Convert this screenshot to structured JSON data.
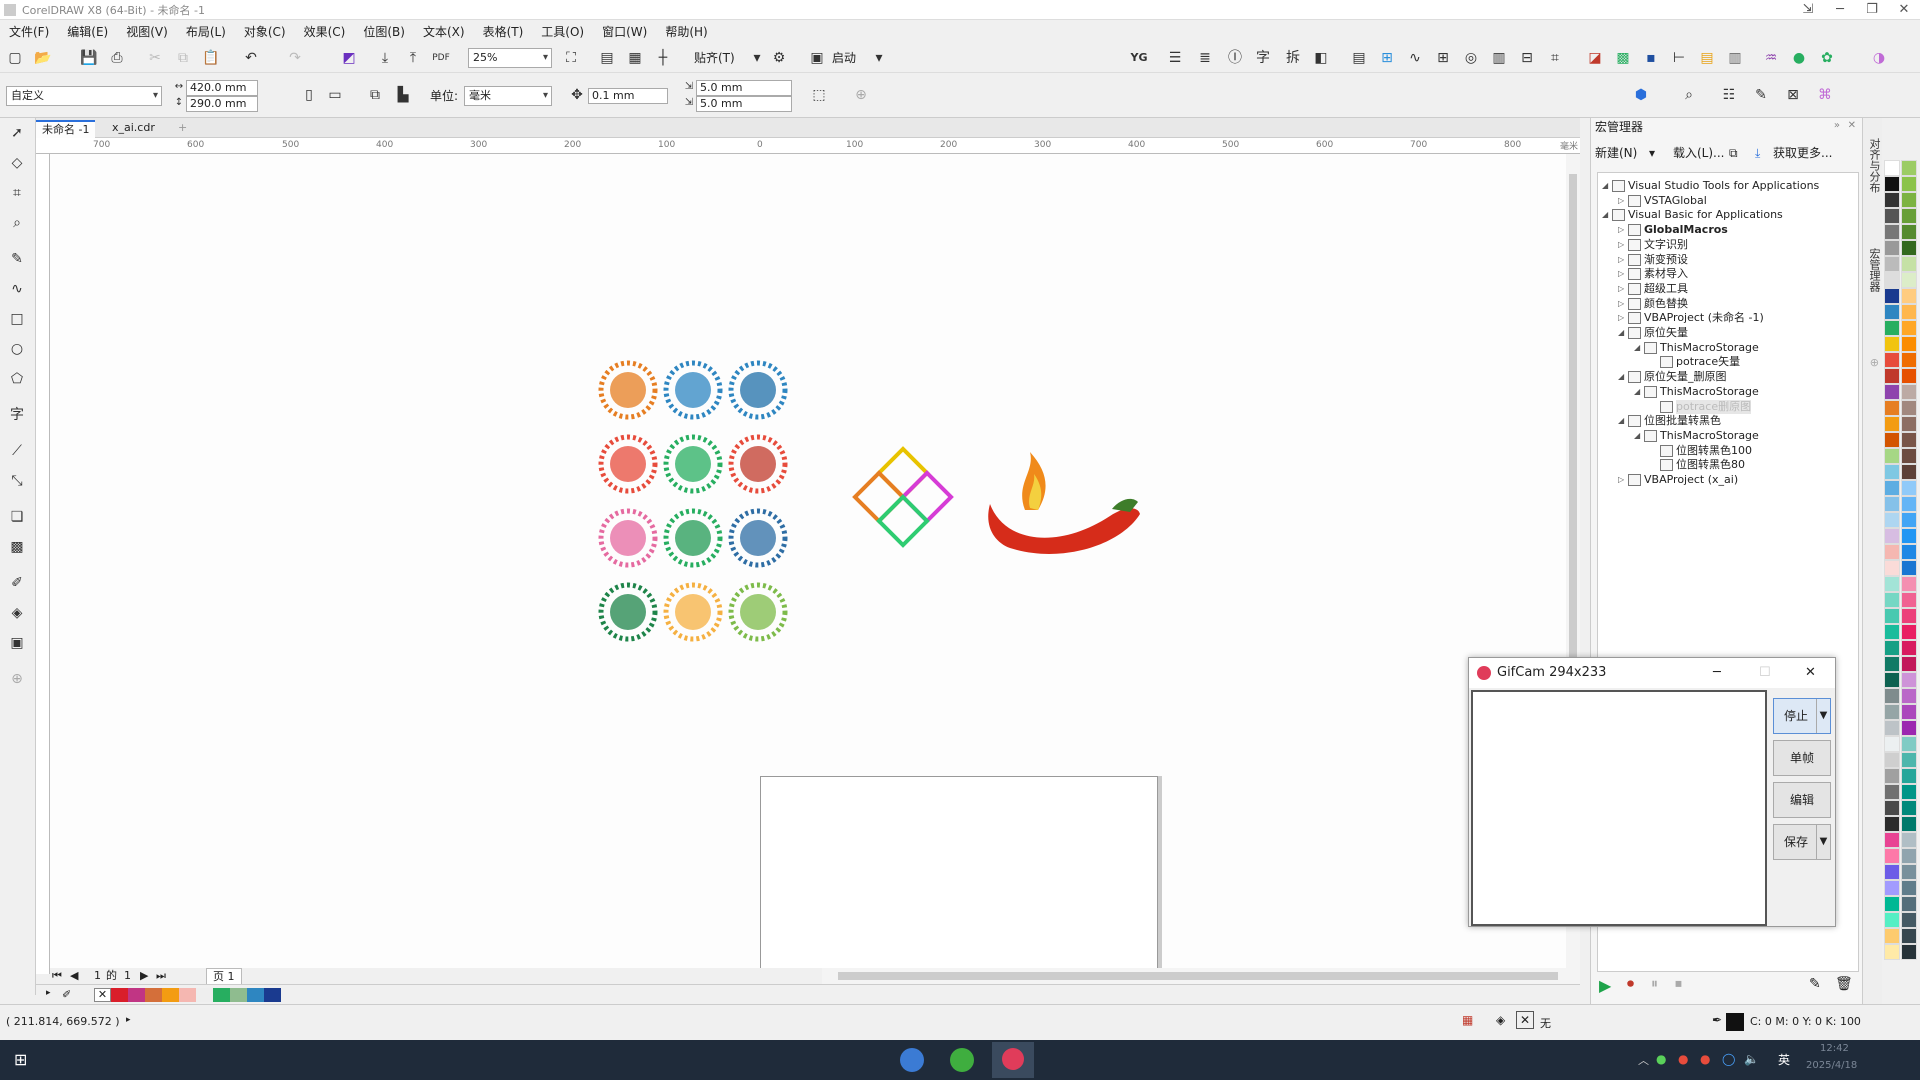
{
  "window": {
    "title": "CorelDRAW X8 (64-Bit) - 未命名 -1"
  },
  "menu": [
    "文件(F)",
    "编辑(E)",
    "视图(V)",
    "布局(L)",
    "对象(C)",
    "效果(C)",
    "位图(B)",
    "文本(X)",
    "表格(T)",
    "工具(O)",
    "窗口(W)",
    "帮助(H)"
  ],
  "toolbar": {
    "zoom": "25%",
    "snap_label": "贴齐(T)",
    "launch_label": "启动",
    "tool_text_yg": "YG",
    "tool_text_zi": "字",
    "tool_text_chai": "拆"
  },
  "property_bar": {
    "preset": "自定义",
    "width": "420.0 mm",
    "height": "290.0 mm",
    "unit_label": "单位:",
    "unit_value": "毫米",
    "nudge": "0.1 mm",
    "dup_x": "5.0 mm",
    "dup_y": "5.0 mm"
  },
  "doc_tabs": [
    "未命名 -1",
    "x_ai.cdr"
  ],
  "ruler_labels": [
    "700",
    "600",
    "500",
    "400",
    "300",
    "200",
    "100",
    "0",
    "100",
    "200",
    "300",
    "400",
    "500",
    "600",
    "700",
    "800"
  ],
  "ruler_unit": "毫米",
  "page_nav": {
    "current": "1",
    "of_label": "的",
    "total": "1",
    "page_tab": "页 1"
  },
  "status": {
    "coords": "( 211.814, 669.572 )",
    "fill_none": "无",
    "color_readout": "C: 0 M: 0 Y: 0 K: 100"
  },
  "macro_panel": {
    "title": "宏管理器",
    "new_label": "新建(N)",
    "load_label": "载入(L)...",
    "more_label": "获取更多...",
    "tree": [
      {
        "label": "Visual Studio Tools for Applications",
        "level": 0,
        "exp": "open"
      },
      {
        "label": "VSTAGlobal",
        "level": 1,
        "exp": "closed"
      },
      {
        "label": "Visual Basic for Applications",
        "level": 0,
        "exp": "open"
      },
      {
        "label": "GlobalMacros",
        "level": 1,
        "exp": "closed",
        "bold": true
      },
      {
        "label": "文字识别",
        "level": 1,
        "exp": "closed"
      },
      {
        "label": "渐变预设",
        "level": 1,
        "exp": "closed"
      },
      {
        "label": "素材导入",
        "level": 1,
        "exp": "closed"
      },
      {
        "label": "超级工具",
        "level": 1,
        "exp": "closed"
      },
      {
        "label": "颜色替换",
        "level": 1,
        "exp": "closed"
      },
      {
        "label": "VBAProject (未命名 -1)",
        "level": 1,
        "exp": "closed"
      },
      {
        "label": "原位矢量",
        "level": 1,
        "exp": "open"
      },
      {
        "label": "ThisMacroStorage",
        "level": 2,
        "exp": "open"
      },
      {
        "label": "potrace矢量",
        "level": 3,
        "exp": "none"
      },
      {
        "label": "原位矢量_删原图",
        "level": 1,
        "exp": "open"
      },
      {
        "label": "ThisMacroStorage",
        "level": 2,
        "exp": "open"
      },
      {
        "label": "potrace删原图",
        "level": 3,
        "exp": "none",
        "selected": true
      },
      {
        "label": "位图批量转黑色",
        "level": 1,
        "exp": "open"
      },
      {
        "label": "ThisMacroStorage",
        "level": 2,
        "exp": "open"
      },
      {
        "label": "位图转黑色100",
        "level": 3,
        "exp": "none"
      },
      {
        "label": "位图转黑色80",
        "level": 3,
        "exp": "none"
      },
      {
        "label": "VBAProject (x_ai)",
        "level": 1,
        "exp": "closed"
      }
    ]
  },
  "dock_tabs": [
    "对齐与分布",
    "宏管理器"
  ],
  "gifcam": {
    "title": "GifCam 294x233",
    "stop": "停止",
    "frame": "单帧",
    "edit": "编辑",
    "save": "保存"
  },
  "taskbar": {
    "ime": "英",
    "time": "12:42",
    "date": "2025/4/18"
  }
}
